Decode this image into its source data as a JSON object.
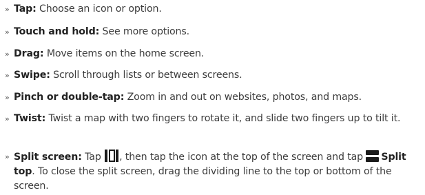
{
  "items": [
    {
      "term": "Tap:",
      "desc": "Choose an icon or option."
    },
    {
      "term": "Touch and hold:",
      "desc": "See more options."
    },
    {
      "term": "Drag:",
      "desc": "Move items on the home screen."
    },
    {
      "term": "Swipe:",
      "desc": "Scroll through lists or between screens."
    },
    {
      "term": "Pinch or double-tap:",
      "desc": "Zoom in and out on websites, photos, and maps."
    },
    {
      "term": "Twist:",
      "desc": "Twist a map with two fingers to rotate it, and slide two fingers up to tilt it."
    }
  ],
  "split_screen": {
    "term": "Split screen:",
    "part1": "Tap",
    "part2": ", then tap the icon at the top of the screen and tap",
    "split_top_label": "Split top",
    "part3": ". To close the split screen, drag the dividing line to the top or bottom of the screen."
  },
  "bullet": "»",
  "icons": {
    "recent_apps": "recent-apps-icon",
    "split_top": "split-top-icon"
  }
}
